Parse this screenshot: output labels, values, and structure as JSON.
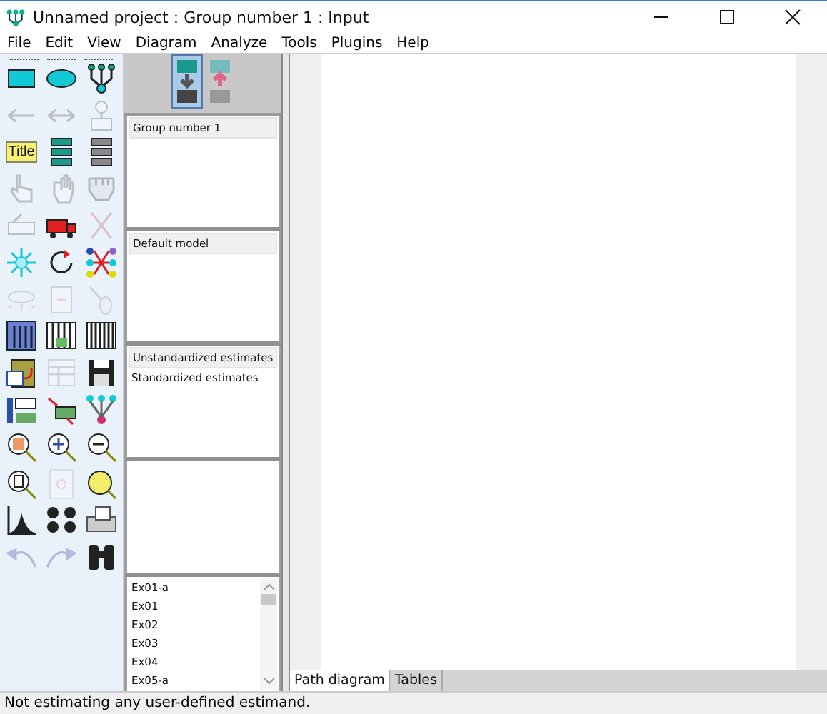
{
  "window": {
    "title": "Unnamed project : Group number 1 : Input"
  },
  "menu": [
    "File",
    "Edit",
    "View",
    "Diagram",
    "Analyze",
    "Tools",
    "Plugins",
    "Help"
  ],
  "toolbar": [
    {
      "disabled": false
    },
    {
      "disabled": false
    },
    {
      "disabled": false
    },
    {
      "disabled": true
    },
    {
      "disabled": true
    },
    {
      "disabled": true
    },
    {
      "disabled": false,
      "label": "Title"
    },
    {
      "disabled": false
    },
    {
      "disabled": false
    },
    {
      "disabled": true
    },
    {
      "disabled": true
    },
    {
      "disabled": true
    },
    {
      "disabled": true
    },
    {
      "disabled": false
    },
    {
      "disabled": true
    },
    {
      "disabled": false
    },
    {
      "disabled": false
    },
    {
      "disabled": false
    },
    {
      "disabled": true
    },
    {
      "disabled": true
    },
    {
      "disabled": true
    },
    {
      "disabled": false
    },
    {
      "disabled": false
    },
    {
      "disabled": false
    },
    {
      "disabled": false
    },
    {
      "disabled": true
    },
    {
      "disabled": false
    },
    {
      "disabled": false
    },
    {
      "disabled": false
    },
    {
      "disabled": false
    },
    {
      "disabled": false
    },
    {
      "disabled": false
    },
    {
      "disabled": false
    },
    {
      "disabled": false
    },
    {
      "disabled": true
    },
    {
      "disabled": false
    },
    {
      "disabled": false
    },
    {
      "disabled": false
    },
    {
      "disabled": false
    },
    {
      "disabled": true
    },
    {
      "disabled": true
    },
    {
      "disabled": false
    }
  ],
  "view_toggles": [
    {
      "selected": true
    },
    {
      "selected": false
    }
  ],
  "groups": [
    {
      "label": "Group number 1",
      "selected": true
    }
  ],
  "models": [
    {
      "label": "Default model",
      "selected": true
    }
  ],
  "estimates": [
    {
      "label": "Unstandardized estimates",
      "selected": true
    },
    {
      "label": "Standardized estimates",
      "selected": false
    }
  ],
  "files": [
    "Ex01-a",
    "Ex01",
    "Ex02",
    "Ex03",
    "Ex04",
    "Ex05-a"
  ],
  "tabs": [
    {
      "label": "Path diagram",
      "selected": true
    },
    {
      "label": "Tables",
      "selected": false
    }
  ],
  "status_bar": "Not estimating any user-defined estimand."
}
